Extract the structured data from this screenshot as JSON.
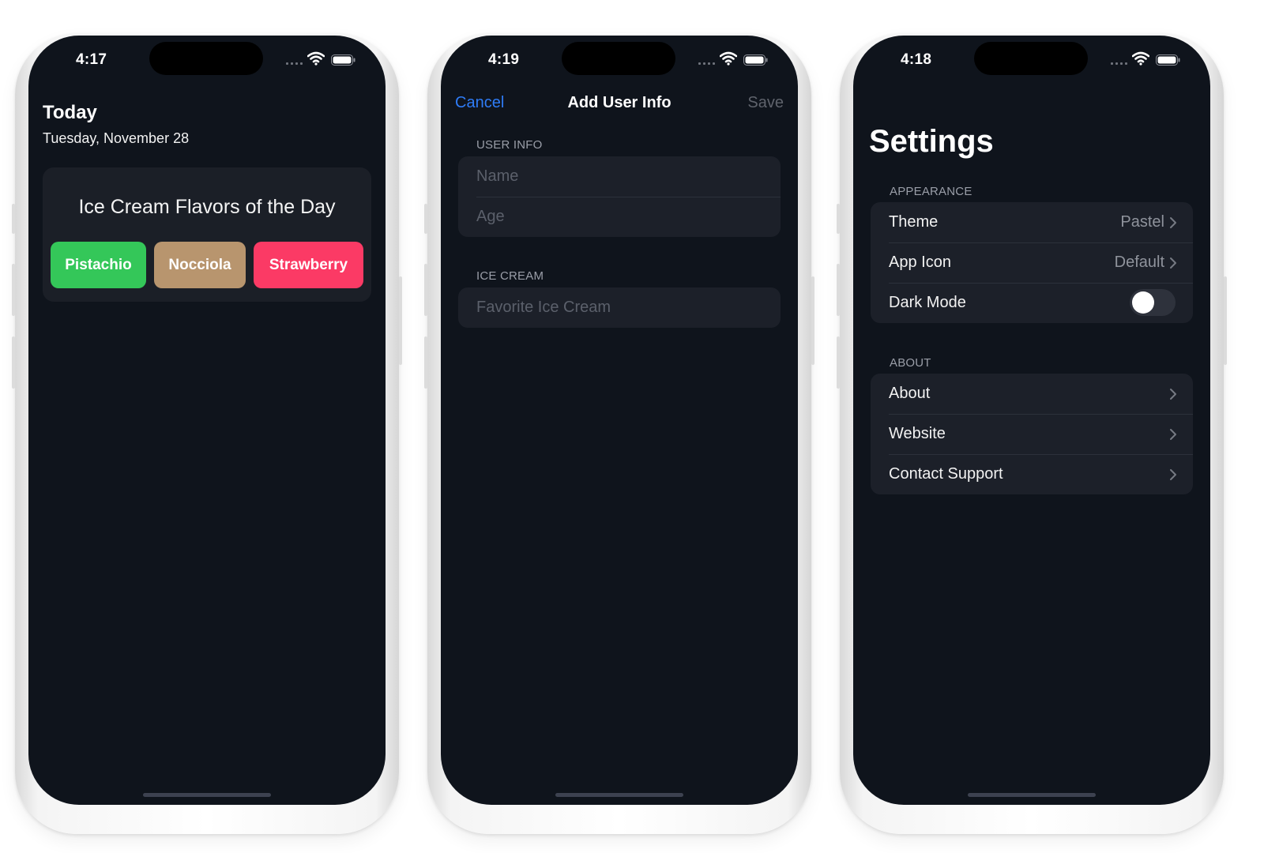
{
  "status_times": [
    "4:17",
    "4:19",
    "4:18"
  ],
  "today": {
    "title": "Today",
    "date": "Tuesday, November 28",
    "card_heading": "Ice Cream Flavors of the Day",
    "flavors": [
      {
        "label": "Pistachio",
        "color": "#34c759"
      },
      {
        "label": "Nocciola",
        "color": "#b8956e"
      },
      {
        "label": "Strawberry",
        "color": "#fb3a65"
      }
    ]
  },
  "add_user": {
    "cancel_label": "Cancel",
    "title": "Add User Info",
    "save_label": "Save",
    "user_info_section": "USER INFO",
    "name_placeholder": "Name",
    "age_placeholder": "Age",
    "ice_cream_section": "ICE CREAM",
    "favorite_placeholder": "Favorite Ice Cream"
  },
  "settings": {
    "title": "Settings",
    "appearance_section": "APPEARANCE",
    "theme_label": "Theme",
    "theme_value": "Pastel",
    "app_icon_label": "App Icon",
    "app_icon_value": "Default",
    "dark_mode_label": "Dark Mode",
    "dark_mode_on": false,
    "about_section": "ABOUT",
    "about_label": "About",
    "website_label": "Website",
    "contact_label": "Contact Support"
  },
  "colors": {
    "background": "#0f141c",
    "accent_blue": "#2f7cf6",
    "card": "#1c2029"
  },
  "icons": [
    "cellular-signal-icon",
    "wifi-icon",
    "battery-icon",
    "chevron-right-icon"
  ]
}
